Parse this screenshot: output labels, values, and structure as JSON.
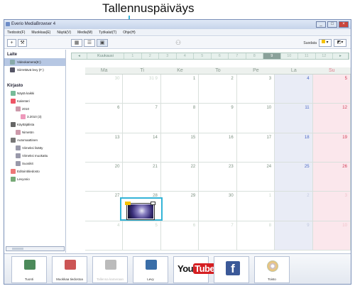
{
  "annotation": {
    "label": "Tallennuspäiväys",
    "line_color": "#34b4d7"
  },
  "window": {
    "title": "Everio MediaBrowser 4",
    "buttons": [
      "_",
      "□",
      "×"
    ]
  },
  "menu": [
    "Tiedosto(F)",
    "Muokkaa(E)",
    "Näytä(V)",
    "Media(M)",
    "Työkalut(T)",
    "Ohje(H)"
  ],
  "toolbar": {
    "add_label": "+",
    "tools_label": "⚒",
    "sort_label": "Suodata",
    "view_icons": [
      "▦",
      "☰",
      "▣"
    ]
  },
  "sidebar": {
    "devices_heading": "Laite",
    "devices": [
      {
        "label": "Videokamera(E:)",
        "selected": true
      },
      {
        "label": "Siirrettävä levy (F:)",
        "selected": false
      }
    ],
    "library_heading": "Kirjasto",
    "library": [
      {
        "label": "Näytä kaikki",
        "level": 0
      },
      {
        "label": "Kalenteri",
        "level": 0
      },
      {
        "label": "2010",
        "level": 1
      },
      {
        "label": "3.2010 (3)",
        "level": 2
      },
      {
        "label": "Käyttäjälista",
        "level": 0
      },
      {
        "label": "Nimetön",
        "level": 1
      },
      {
        "label": "Automaattinen",
        "level": 0
      },
      {
        "label": "Viimeksi lisätty",
        "level": 1
      },
      {
        "label": "Viimeksi muokattu",
        "level": 1
      },
      {
        "label": "Suosikit",
        "level": 1
      },
      {
        "label": "Editointitiedosto",
        "level": 0
      },
      {
        "label": "Levyosio",
        "level": 0
      }
    ]
  },
  "calendar": {
    "month_strip": [
      "◂",
      "Kuukausi",
      "1",
      "2",
      "3",
      "4",
      "5",
      "6",
      "7",
      "8",
      "9",
      "10",
      "11",
      "12",
      "▸"
    ],
    "current_month_index": 10,
    "weekdays": [
      "Ma",
      "Ti",
      "Ke",
      "To",
      "Pe",
      "La",
      "Su"
    ],
    "weeks": [
      [
        {
          "d": "30",
          "out": true
        },
        {
          "d": "31 9",
          "out": true
        },
        {
          "d": "1"
        },
        {
          "d": "2"
        },
        {
          "d": "3"
        },
        {
          "d": "4"
        },
        {
          "d": "5"
        }
      ],
      [
        {
          "d": "6"
        },
        {
          "d": "7"
        },
        {
          "d": "8"
        },
        {
          "d": "9"
        },
        {
          "d": "10"
        },
        {
          "d": "11"
        },
        {
          "d": "12"
        }
      ],
      [
        {
          "d": "13"
        },
        {
          "d": "14"
        },
        {
          "d": "15"
        },
        {
          "d": "16"
        },
        {
          "d": "17"
        },
        {
          "d": "18"
        },
        {
          "d": "19"
        }
      ],
      [
        {
          "d": "20"
        },
        {
          "d": "21"
        },
        {
          "d": "22"
        },
        {
          "d": "23"
        },
        {
          "d": "24"
        },
        {
          "d": "25"
        },
        {
          "d": "26"
        }
      ],
      [
        {
          "d": "27"
        },
        {
          "d": "28"
        },
        {
          "d": "29"
        },
        {
          "d": "30"
        },
        {
          "d": "1",
          "out": true
        },
        {
          "d": "2",
          "out": true
        },
        {
          "d": "3",
          "out": true
        }
      ],
      [
        {
          "d": "4",
          "out": true
        },
        {
          "d": "5",
          "out": true
        },
        {
          "d": "6",
          "out": true
        },
        {
          "d": "7",
          "out": true
        },
        {
          "d": "8",
          "out": true
        },
        {
          "d": "9",
          "out": true
        },
        {
          "d": "10",
          "out": true
        }
      ]
    ],
    "thumbnail_day": "28"
  },
  "bottom_buttons": [
    {
      "label": "Tuonti",
      "icon": "import-icon",
      "disabled": false
    },
    {
      "label": "Muokkaa tiedostoa",
      "icon": "edit-icon",
      "disabled": false
    },
    {
      "label": "Tallenna kameraan",
      "icon": "camera-icon",
      "disabled": true
    },
    {
      "label": "Levy",
      "icon": "disc-create-icon",
      "disabled": false
    },
    {
      "label": "",
      "icon": "youtube-icon",
      "disabled": false
    },
    {
      "label": "",
      "icon": "facebook-icon",
      "disabled": false
    },
    {
      "label": "Toisto",
      "icon": "dvd-icon",
      "disabled": false
    }
  ]
}
